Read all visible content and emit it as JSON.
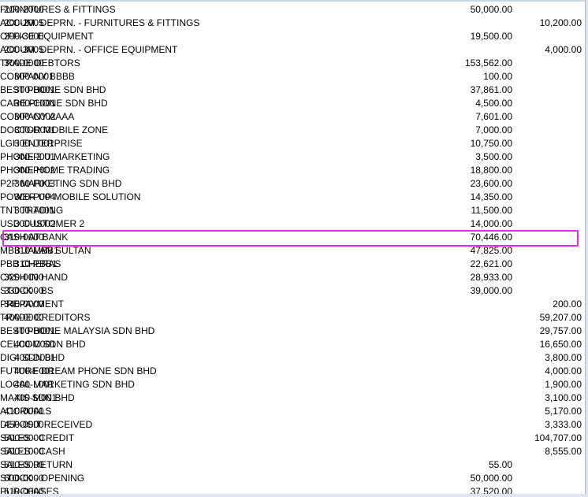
{
  "accounts": [
    {
      "code": "200-2000",
      "description": "FURNITURES & FITTINGS",
      "debit": "50,000.00",
      "credit": "",
      "sub": false
    },
    {
      "code": "200-2005",
      "description": "ACCUM. DEPRN. - FURNITURES & FITTINGS",
      "debit": "",
      "credit": "10,200.00",
      "sub": false
    },
    {
      "code": "200-3000",
      "description": "OFFICE EQUIPMENT",
      "debit": "19,500.00",
      "credit": "",
      "sub": false
    },
    {
      "code": "200-3005",
      "description": "ACCUM. DEPRN. - OFFICE EQUIPMENT",
      "debit": "",
      "credit": "4,000.00",
      "sub": false
    },
    {
      "code": "300-0000",
      "description": "TRADE DEBTORS",
      "debit": "153,562.00",
      "credit": "",
      "sub": false
    },
    {
      "code": "300-0001",
      "description": "COMPANY BBBB",
      "debit": "100.00",
      "credit": "",
      "sub": true
    },
    {
      "code": "300-B001",
      "description": "BEST PHONE SDN BHD",
      "debit": "37,861.00",
      "credit": "",
      "sub": true
    },
    {
      "code": "300-C001",
      "description": "CARE PHONE SDN BHD",
      "debit": "4,500.00",
      "credit": "",
      "sub": true
    },
    {
      "code": "300-C002",
      "description": "COMPANY AAAA",
      "debit": "7,601.00",
      "credit": "",
      "sub": true
    },
    {
      "code": "300-D001",
      "description": "DOCTOR MOBILE ZONE",
      "debit": "7,000.00",
      "credit": "",
      "sub": true
    },
    {
      "code": "300-L001",
      "description": "LGH ENTERPRISE",
      "debit": "10,750.00",
      "credit": "",
      "sub": true
    },
    {
      "code": "300-P001",
      "description": "PHONE 2 U MARKETING",
      "debit": "3,500.00",
      "credit": "",
      "sub": true
    },
    {
      "code": "300-P002",
      "description": "PHONE HOME TRADING",
      "debit": "18,800.00",
      "credit": "",
      "sub": true
    },
    {
      "code": "300-P003",
      "description": "P2P MARKETING SDN BHD",
      "debit": "23,600.00",
      "credit": "",
      "sub": true
    },
    {
      "code": "300-P004",
      "description": "POWER UP MOBILE SOLUTION",
      "debit": "14,350.00",
      "credit": "",
      "sub": true
    },
    {
      "code": "300-T001",
      "description": "TNT TRADING",
      "debit": "11,500.00",
      "credit": "",
      "sub": true
    },
    {
      "code": "300-U002",
      "description": "USD CUSTOMER 2",
      "debit": "14,000.00",
      "credit": "",
      "sub": true
    },
    {
      "code": "310-0000",
      "description": "CASH AT BANK",
      "debit": "70,446.00",
      "credit": "",
      "sub": false
    },
    {
      "code": "310-MBB1",
      "description": "MBB JALAN SULTAN",
      "debit": "47,825.00",
      "credit": "",
      "sub": true
    },
    {
      "code": "310-PBB1",
      "description": "PBB CHERAS",
      "debit": "22,621.00",
      "credit": "",
      "sub": true
    },
    {
      "code": "320-0000",
      "description": "CASH IN HAND",
      "debit": "28,933.00",
      "credit": "",
      "sub": false
    },
    {
      "code": "330-0000",
      "description": "STOCK - BS",
      "debit": "39,000.00",
      "credit": "",
      "sub": false
    },
    {
      "code": "340-0000",
      "description": "PREPAYMENT",
      "debit": "",
      "credit": "200.00",
      "sub": false
    },
    {
      "code": "400-0000",
      "description": "TRADE CREDITORS",
      "debit": "",
      "credit": "59,207.00",
      "sub": false
    },
    {
      "code": "400-B001",
      "description": "BEST PHONE MALAYSIA SDN BHD",
      "debit": "",
      "credit": "29,757.00",
      "sub": true
    },
    {
      "code": "400-C001",
      "description": "CELCOM SDN BHD",
      "debit": "",
      "credit": "16,650.00",
      "sub": true
    },
    {
      "code": "400-D001",
      "description": "DIGI SDN BHD",
      "debit": "",
      "credit": "3,800.00",
      "sub": true
    },
    {
      "code": "400-F001",
      "description": "FUTURE DREAM PHONE SDN BHD",
      "debit": "",
      "credit": "4,000.00",
      "sub": true
    },
    {
      "code": "400-L001",
      "description": "LOCAL MARKETING SDN BHD",
      "debit": "",
      "credit": "1,900.00",
      "sub": true
    },
    {
      "code": "400-M001",
      "description": "MAXIS SDN BHD",
      "debit": "",
      "credit": "3,100.00",
      "sub": true
    },
    {
      "code": "410-0000",
      "description": "ACCRUALS",
      "debit": "",
      "credit": "5,170.00",
      "sub": false
    },
    {
      "code": "450-0000",
      "description": "DEPOSIT RECEIVED",
      "debit": "",
      "credit": "3,333.00",
      "sub": false
    },
    {
      "code": "500-0000",
      "description": "SALES - CREDIT",
      "debit": "",
      "credit": "104,707.00",
      "sub": false
    },
    {
      "code": "500-1000",
      "description": "SALES - CASH",
      "debit": "",
      "credit": "8,555.00",
      "sub": false
    },
    {
      "code": "510-0000",
      "description": "SALES RETURN",
      "debit": "55.00",
      "credit": "",
      "sub": false
    },
    {
      "code": "600-0000",
      "description": "STOCK - OPENING",
      "debit": "50,000.00",
      "credit": "",
      "sub": false
    },
    {
      "code": "610-0000",
      "description": "PURCHASES",
      "debit": "37,520.00",
      "credit": "",
      "sub": false
    }
  ],
  "highlight": {
    "color": "#ee22ee",
    "row_code": "310-0000"
  }
}
